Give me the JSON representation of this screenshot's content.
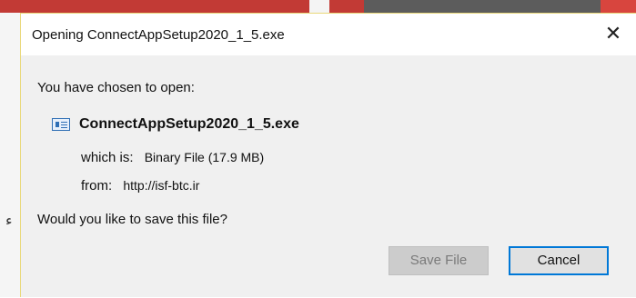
{
  "dialog": {
    "title": "Opening ConnectAppSetup2020_1_5.exe",
    "close_symbol": "✕",
    "intro": "You have chosen to open:",
    "file_name": "ConnectAppSetup2020_1_5.exe",
    "file_icon": "executable-file-icon",
    "which_label": "which is:",
    "which_value": "Binary File (17.9 MB)",
    "from_label": "from:",
    "from_value": "http://isf-btc.ir",
    "question": "Would you like to save this file?",
    "buttons": {
      "save": "Save File",
      "cancel": "Cancel"
    }
  },
  "background": {
    "left_glyph": "ﺀ"
  }
}
